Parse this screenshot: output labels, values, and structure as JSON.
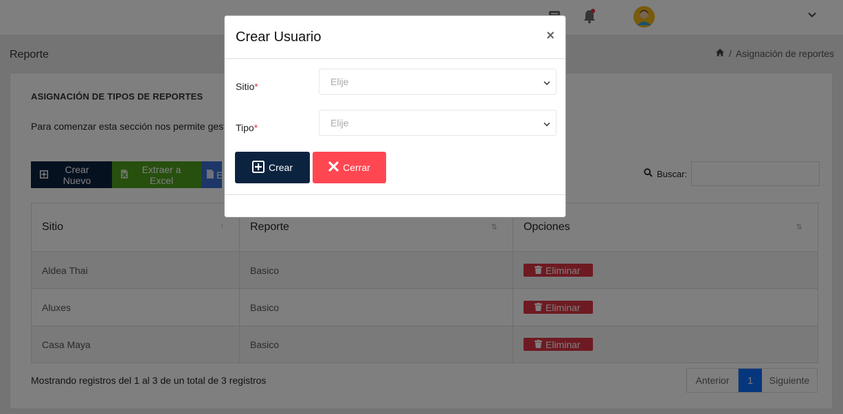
{
  "header": {
    "icons": [
      "chat-icon",
      "bell-icon",
      "user-avatar",
      "chevron-down-icon"
    ],
    "notification_dot_color": "#dc3545"
  },
  "page": {
    "title": "Reporte",
    "breadcrumb_current": "Asignación de reportes"
  },
  "card": {
    "title": "ASIGNACIÓN DE TIPOS DE REPORTES",
    "description": "Para comenzar esta sección nos permite gest"
  },
  "toolbar": {
    "new_label": "Crear Nuevo",
    "excel_label": "Extraer a Excel",
    "pdf_label": "E"
  },
  "search": {
    "label": "Buscar:",
    "value": ""
  },
  "table": {
    "headers": [
      "Sitio",
      "Reporte",
      "Opciones"
    ],
    "rows": [
      {
        "sitio": "Aldea Thai",
        "reporte": "Basico",
        "action": "Eliminar"
      },
      {
        "sitio": "Aluxes",
        "reporte": "Basico",
        "action": "Eliminar"
      },
      {
        "sitio": "Casa Maya",
        "reporte": "Basico",
        "action": "Eliminar"
      }
    ]
  },
  "footer": {
    "info": "Mostrando registros del 1 al 3 de un total de 3 registros",
    "prev": "Anterior",
    "page": "1",
    "next": "Siguiente"
  },
  "modal": {
    "title": "Crear Usuario",
    "close": "×",
    "fields": [
      {
        "label": "Sitio",
        "required": "*",
        "placeholder": "Elije"
      },
      {
        "label": "Tipo",
        "required": "*",
        "placeholder": "Elije"
      }
    ],
    "create_label": "Crear",
    "close_label": "Cerrar"
  },
  "colors": {
    "primary": "#0c2340",
    "excel": "#4e9e1c",
    "pdf": "#3c6fd1",
    "danger": "#dc3545",
    "cerrar": "#ff4752",
    "pager_active": "#0d6efd"
  }
}
